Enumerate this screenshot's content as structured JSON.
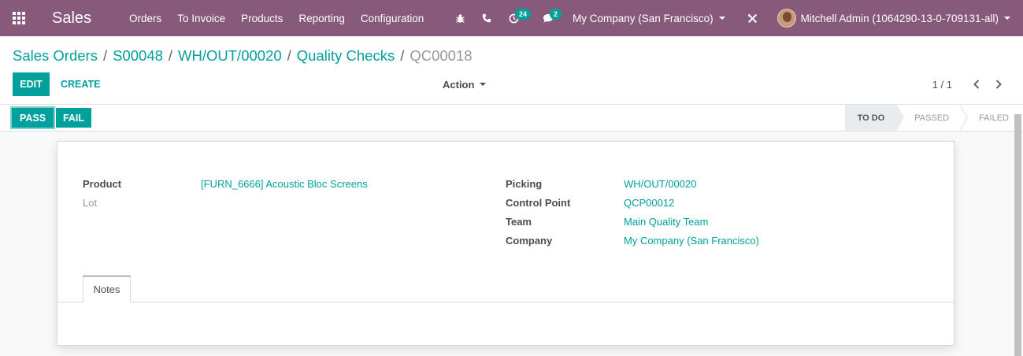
{
  "navbar": {
    "app_name": "Sales",
    "menu": [
      "Orders",
      "To Invoice",
      "Products",
      "Reporting",
      "Configuration"
    ],
    "activity_count": "24",
    "message_count": "2",
    "company": "My Company (San Francisco)",
    "user": "Mitchell Admin (1064290-13-0-709131-all)",
    "bar_color": "#875a7b"
  },
  "breadcrumb": {
    "items": [
      "Sales Orders",
      "S00048",
      "WH/OUT/00020",
      "Quality Checks"
    ],
    "current": "QC00018"
  },
  "toolbar": {
    "edit_label": "EDIT",
    "create_label": "CREATE",
    "action_label": "Action",
    "pager": "1 / 1"
  },
  "statusbar": {
    "pass_label": "PASS",
    "fail_label": "FAIL",
    "stages": [
      "TO DO",
      "PASSED",
      "FAILED"
    ],
    "active_stage": "TO DO"
  },
  "form": {
    "left": [
      {
        "label": "Product",
        "value": "[FURN_6666] Acoustic Bloc Screens"
      },
      {
        "label": "Lot",
        "value": ""
      }
    ],
    "right": [
      {
        "label": "Picking",
        "value": "WH/OUT/00020"
      },
      {
        "label": "Control Point",
        "value": "QCP00012"
      },
      {
        "label": "Team",
        "value": "Main Quality Team"
      },
      {
        "label": "Company",
        "value": "My Company (San Francisco)"
      }
    ],
    "tab_label": "Notes"
  },
  "accent_color": "#00a09d"
}
